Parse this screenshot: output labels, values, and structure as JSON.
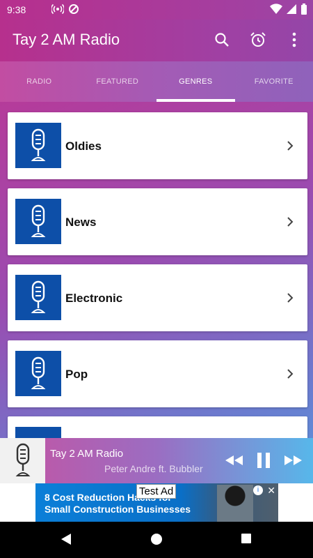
{
  "status": {
    "time": "9:38"
  },
  "app": {
    "title": "Tay 2 AM Radio"
  },
  "tabs": [
    {
      "label": "RADIO"
    },
    {
      "label": "FEATURED"
    },
    {
      "label": "GENRES"
    },
    {
      "label": "FAVORITE"
    }
  ],
  "genres": [
    {
      "label": "Oldies"
    },
    {
      "label": "News"
    },
    {
      "label": "Electronic"
    },
    {
      "label": "Pop"
    }
  ],
  "player": {
    "station": "Tay 2 AM Radio",
    "artist": "Peter Andre ft. Bubbler"
  },
  "ad": {
    "label": "Test Ad",
    "line1": "8 Cost Reduction Hacks for",
    "line2": "Small Construction Businesses"
  },
  "colors": {
    "accent": "#b6308d",
    "thumb": "#0d4fa8"
  }
}
